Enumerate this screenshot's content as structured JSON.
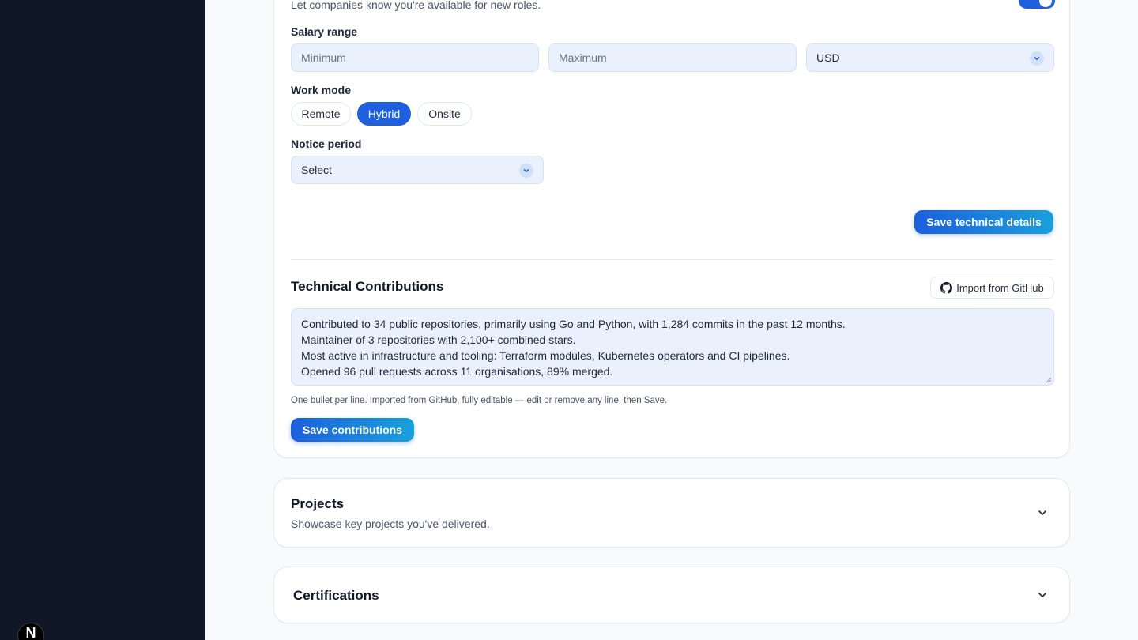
{
  "availability": {
    "hint": "Let companies know you're available for new roles.",
    "toggle_on": true
  },
  "salary": {
    "label": "Salary range",
    "min_placeholder": "Minimum",
    "max_placeholder": "Maximum",
    "currency": "USD"
  },
  "work_mode": {
    "label": "Work mode",
    "options": [
      "Remote",
      "Hybrid",
      "Onsite"
    ],
    "selected": "Hybrid"
  },
  "notice": {
    "label": "Notice period",
    "value": "Select"
  },
  "save_technical_label": "Save technical details",
  "contributions": {
    "title": "Technical Contributions",
    "import_label": "Import from GitHub",
    "lines": [
      "Contributed to 34 public repositories, primarily using Go and Python, with 1,284 commits in the past 12 months.",
      "Maintainer of 3 repositories with 2,100+ combined stars.",
      "Most active in infrastructure and tooling: Terraform modules, Kubernetes operators and CI pipelines.",
      "Opened 96 pull requests across 11 organisations, 89% merged."
    ],
    "helper": "One bullet per line. Imported from GitHub, fully editable — edit or remove any line, then Save.",
    "save_label": "Save contributions"
  },
  "projects": {
    "title": "Projects",
    "subtitle": "Showcase key projects you've delivered."
  },
  "certifications": {
    "title": "Certifications"
  },
  "colors": {
    "sidebar": "#101828",
    "accent": "#1d5fdc",
    "accent_gradient_end": "#1aa0db",
    "input_bg": "#eaf1fc"
  }
}
